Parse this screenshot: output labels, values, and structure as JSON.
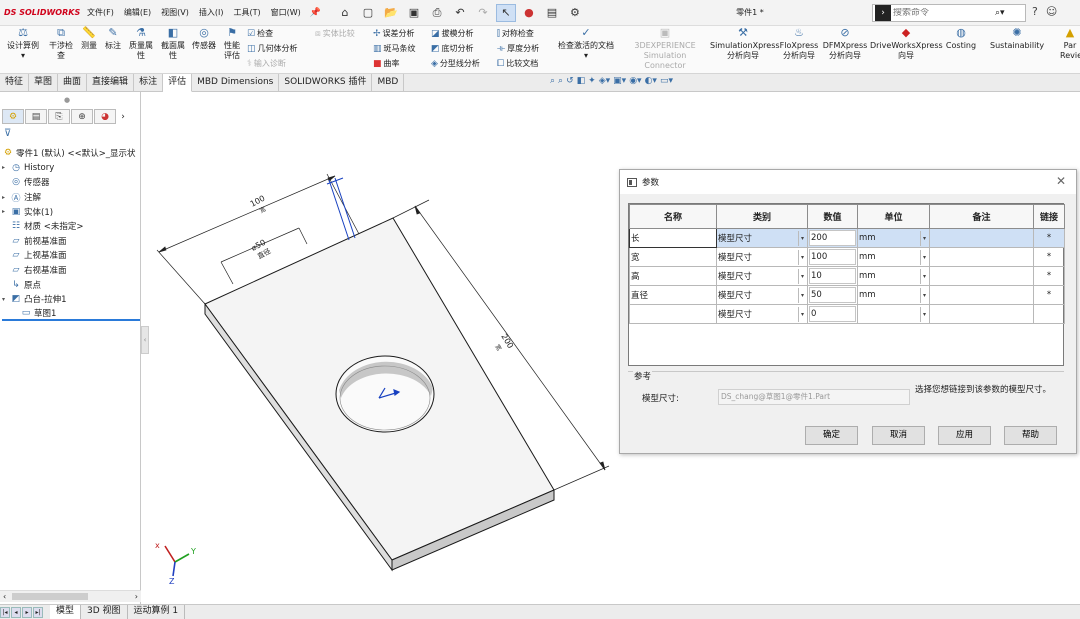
{
  "titlebar": {
    "logo": "DS SOLIDWORKS",
    "menus": [
      "文件(F)",
      "编辑(E)",
      "视图(V)",
      "插入(I)",
      "工具(T)",
      "窗口(W)"
    ],
    "document_title": "零件1 *",
    "search_placeholder": "搜索命令"
  },
  "ribbon": {
    "design_study": "设计算例",
    "interference": "干涉检查",
    "measure": "测量",
    "markup": "标注",
    "mass_props": "质量属性",
    "section_props": "截面属性",
    "sensor": "传感器",
    "perf_eval": "性能评估",
    "check": "检查",
    "geometry_analysis": "几何体分析",
    "import_diag": "输入诊断",
    "entity_compare": "实体比较",
    "deviation": "误差分析",
    "zebra": "斑马条纹",
    "curvature": "曲率",
    "draft": "拔模分析",
    "undercut": "底切分析",
    "parting": "分型线分析",
    "symmetry": "对称检查",
    "thickness": "厚度分析",
    "compare_doc": "比较文档",
    "check_active": "检查激活的文档",
    "experience": "3DEXPERIENCE",
    "sim_connector": "Simulation Connector",
    "simxpress": "SimulationXpress",
    "floxpress": "FloXpress",
    "dfmxpress": "DFMXpress",
    "driveworks": "DriveWorksXpress",
    "wizard": "分析向导",
    "wizard2": "向导",
    "costing": "Costing",
    "sustainability": "Sustainability",
    "part_review": "Par",
    "part_review2": "Revie"
  },
  "command_tabs": [
    "特征",
    "草图",
    "曲面",
    "直接编辑",
    "标注",
    "评估",
    "MBD Dimensions",
    "SOLIDWORKS 插件",
    "MBD"
  ],
  "active_command_tab": "评估",
  "feature_tree": {
    "root": "零件1 (默认) <<默认>_显示状",
    "items": [
      {
        "label": "History",
        "icon": "history-icon"
      },
      {
        "label": "传感器",
        "icon": "sensor-icon"
      },
      {
        "label": "注解",
        "icon": "annotation-icon"
      },
      {
        "label": "实体(1)",
        "icon": "solid-body-icon"
      },
      {
        "label": "材质 <未指定>",
        "icon": "material-icon"
      },
      {
        "label": "前视基准面",
        "icon": "plane-icon"
      },
      {
        "label": "上视基准面",
        "icon": "plane-icon"
      },
      {
        "label": "右视基准面",
        "icon": "plane-icon"
      },
      {
        "label": "原点",
        "icon": "origin-icon"
      },
      {
        "label": "凸台-拉伸1",
        "icon": "extrude-icon"
      },
      {
        "label": "草图1",
        "icon": "sketch-icon"
      }
    ]
  },
  "model": {
    "dim_width": "100",
    "dim_dia": "⌀50",
    "dim_dia_note": "直径",
    "dim_length": "200",
    "dim_suffix": "宽"
  },
  "bottom_tabs": [
    "模型",
    "3D 视图",
    "运动算例 1"
  ],
  "dialog": {
    "title": "参数",
    "columns": [
      "名称",
      "类别",
      "数值",
      "单位",
      "备注",
      "链接"
    ],
    "rows": [
      {
        "name": "长",
        "category": "模型尺寸",
        "value": "200",
        "unit": "mm",
        "note": "",
        "link": "*"
      },
      {
        "name": "宽",
        "category": "模型尺寸",
        "value": "100",
        "unit": "mm",
        "note": "",
        "link": "*"
      },
      {
        "name": "高",
        "category": "模型尺寸",
        "value": "10",
        "unit": "mm",
        "note": "",
        "link": "*"
      },
      {
        "name": "直径",
        "category": "模型尺寸",
        "value": "50",
        "unit": "mm",
        "note": "",
        "link": "*"
      },
      {
        "name": "",
        "category": "模型尺寸",
        "value": "0",
        "unit": "",
        "note": "",
        "link": ""
      }
    ],
    "ref_group": "参考",
    "ref_label": "模型尺寸:",
    "ref_value": "DS_chang@草图1@零件1.Part",
    "ref_hint": "选择您想链接到该参数的模型尺寸。",
    "buttons": {
      "ok": "确定",
      "cancel": "取消",
      "apply": "应用",
      "help": "帮助"
    }
  },
  "colors": {
    "accent": "#3a6ea5",
    "selection": "#cfe0f5",
    "logo": "#d0021b"
  }
}
